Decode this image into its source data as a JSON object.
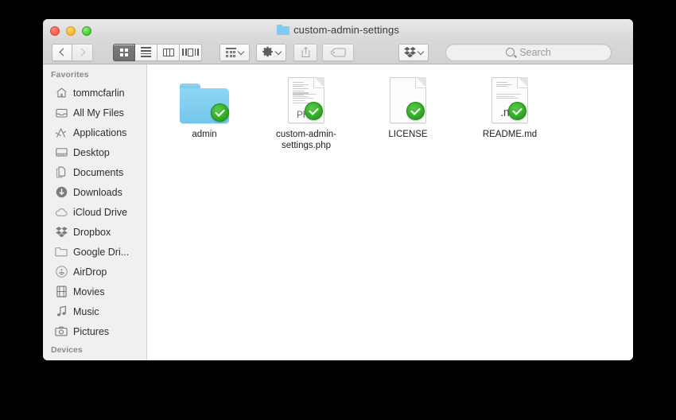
{
  "window": {
    "title": "custom-admin-settings",
    "title_icon": "folder-icon",
    "traffic_lights": [
      {
        "name": "close-button",
        "color": "#f6574b"
      },
      {
        "name": "minimize-button",
        "color": "#f6b322"
      },
      {
        "name": "zoom-button",
        "color": "#43cb31"
      }
    ]
  },
  "toolbar": {
    "back_label": "Back",
    "forward_label": "Forward",
    "views": [
      {
        "name": "icon-view-button",
        "icon": "grid-icon",
        "active": true
      },
      {
        "name": "list-view-button",
        "icon": "list-icon",
        "active": false
      },
      {
        "name": "column-view-button",
        "icon": "columns-icon",
        "active": false
      },
      {
        "name": "coverflow-view-button",
        "icon": "coverflow-icon",
        "active": false
      }
    ],
    "arrange_label": "Arrange",
    "action_label": "Action",
    "share_label": "Share",
    "tags_label": "Tags",
    "dropbox_label": "Dropbox"
  },
  "search": {
    "placeholder": "Search",
    "value": ""
  },
  "sidebar": {
    "favorites_header": "Favorites",
    "devices_header": "Devices",
    "items": [
      {
        "label": "tommcfarlin",
        "icon": "home-icon"
      },
      {
        "label": "All My Files",
        "icon": "all-my-files-icon"
      },
      {
        "label": "Applications",
        "icon": "applications-icon"
      },
      {
        "label": "Desktop",
        "icon": "desktop-icon"
      },
      {
        "label": "Documents",
        "icon": "documents-icon"
      },
      {
        "label": "Downloads",
        "icon": "downloads-icon"
      },
      {
        "label": "iCloud Drive",
        "icon": "icloud-icon"
      },
      {
        "label": "Dropbox",
        "icon": "dropbox-icon"
      },
      {
        "label": "Google Dri...",
        "icon": "folder-icon"
      },
      {
        "label": "AirDrop",
        "icon": "airdrop-icon"
      },
      {
        "label": "Movies",
        "icon": "movies-icon"
      },
      {
        "label": "Music",
        "icon": "music-icon"
      },
      {
        "label": "Pictures",
        "icon": "pictures-icon"
      }
    ]
  },
  "files": [
    {
      "label": "admin",
      "kind": "folder",
      "badge": "synced-check",
      "ext": ""
    },
    {
      "label": "custom-admin-settings.php",
      "kind": "document",
      "badge": "synced-check",
      "ext": "PHP"
    },
    {
      "label": "LICENSE",
      "kind": "document-blank",
      "badge": "synced-check",
      "ext": ""
    },
    {
      "label": "README.md",
      "kind": "document",
      "badge": "synced-check",
      "ext": ".md"
    }
  ],
  "colors": {
    "folder_blue": "#7ecdf0",
    "badge_green": "#2aa31c",
    "sidebar_bg": "#f0f0f0",
    "content_bg": "#ffffff",
    "titlebar_bg": "#d8d8d8"
  }
}
